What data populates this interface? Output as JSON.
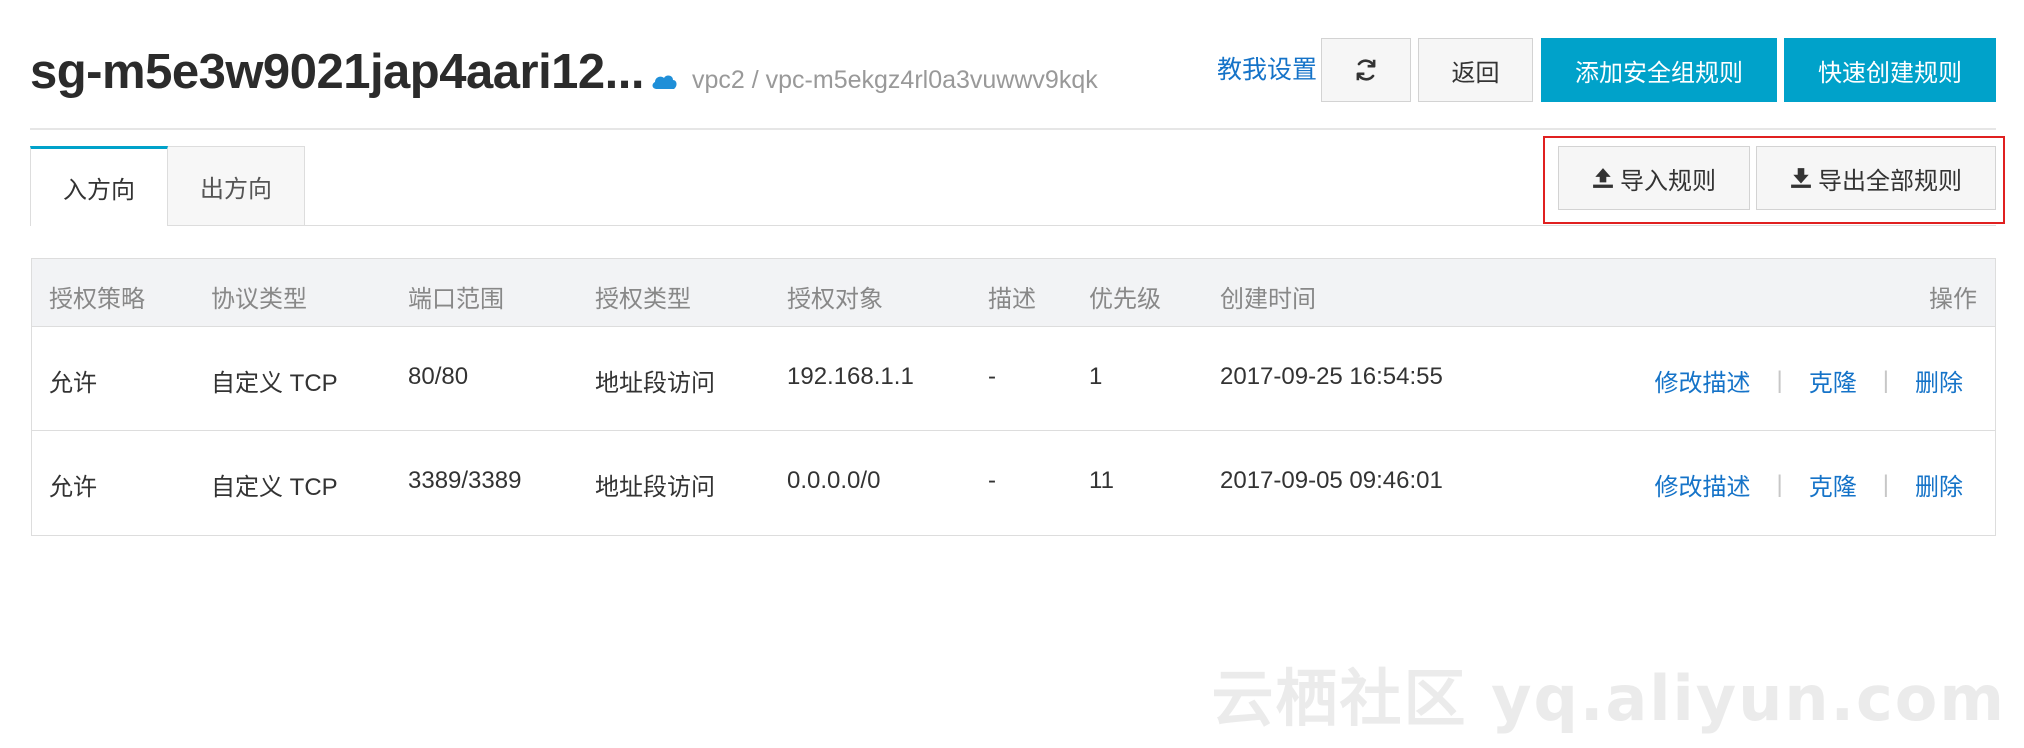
{
  "header": {
    "title": "sg-m5e3w9021jap4aari12...",
    "vpc_text": "vpc2 / vpc-m5ekgz4rl0a3vuwwv9kqk",
    "teach_link": "教我设置",
    "refresh_icon": "refresh-icon",
    "back_label": "返回",
    "add_rule_label": "添加安全组规则",
    "quick_create_label": "快速创建规则",
    "cloud_icon": "cloud-icon"
  },
  "tabs": {
    "inbound": "入方向",
    "outbound": "出方向"
  },
  "actions": {
    "import_label": "导入规则",
    "export_label": "导出全部规则",
    "import_icon": "upload-icon",
    "export_icon": "download-icon"
  },
  "table": {
    "headers": [
      "授权策略",
      "协议类型",
      "端口范围",
      "授权类型",
      "授权对象",
      "描述",
      "优先级",
      "创建时间",
      "操作"
    ],
    "rows": [
      {
        "policy": "允许",
        "protocol": "自定义 TCP",
        "ports": "80/80",
        "auth_type": "地址段访问",
        "target": "192.168.1.1",
        "desc": "-",
        "priority": "1",
        "created": "2017-09-25 16:54:55"
      },
      {
        "policy": "允许",
        "protocol": "自定义 TCP",
        "ports": "3389/3389",
        "auth_type": "地址段访问",
        "target": "0.0.0.0/0",
        "desc": "-",
        "priority": "11",
        "created": "2017-09-05 09:46:01"
      }
    ],
    "ops": {
      "edit": "修改描述",
      "clone": "克隆",
      "delete": "删除",
      "sep": "|"
    }
  },
  "watermark": "云栖社区 yq.aliyun.com",
  "colors": {
    "accent": "#00a2ca",
    "link": "#1573c8",
    "highlight": "#e02020"
  }
}
